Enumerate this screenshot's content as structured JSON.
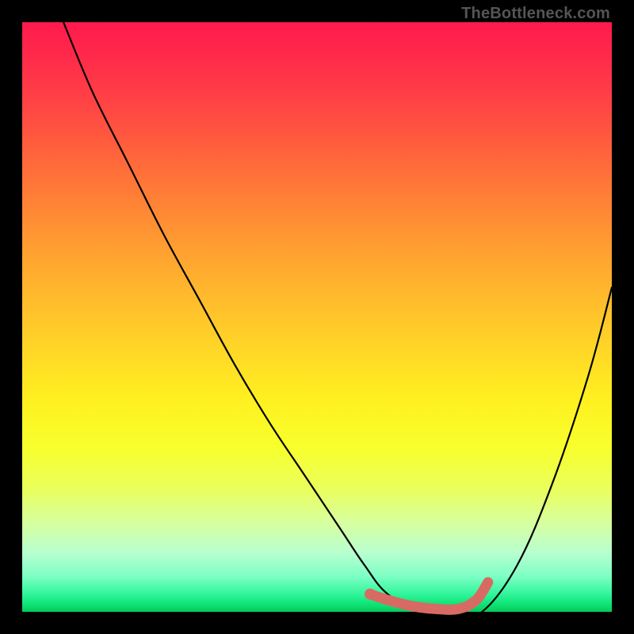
{
  "attribution": "TheBottleneck.com",
  "chart_data": {
    "type": "line",
    "title": "",
    "xlabel": "",
    "ylabel": "",
    "xlim": [
      0,
      100
    ],
    "ylim": [
      0,
      100
    ],
    "grid": false,
    "series": [
      {
        "name": "curve",
        "color": "#000000",
        "x": [
          7,
          12,
          18,
          24,
          30,
          36,
          42,
          48,
          54,
          58,
          62,
          68,
          74,
          78,
          84,
          90,
          96,
          100
        ],
        "values": [
          100,
          88,
          76,
          64,
          53,
          42,
          32,
          23,
          14,
          8,
          3,
          0,
          0,
          0,
          8,
          22,
          40,
          55
        ]
      },
      {
        "name": "highlight",
        "color": "#d86a64",
        "x": [
          59,
          62,
          66,
          70,
          74,
          77,
          79
        ],
        "values": [
          3,
          2,
          1,
          0.5,
          0.5,
          2,
          5
        ]
      }
    ],
    "annotations": [
      {
        "name": "highlight-start-dot",
        "x": 59,
        "y": 3,
        "color": "#d86a64"
      }
    ]
  }
}
